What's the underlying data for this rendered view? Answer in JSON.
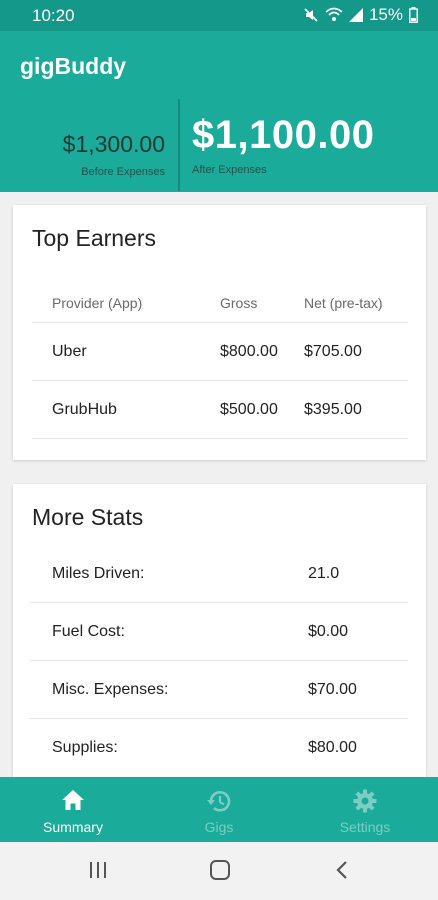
{
  "status": {
    "time": "10:20",
    "battery": "15%"
  },
  "app": {
    "title": "gigBuddy"
  },
  "totals": {
    "before_amount": "$1,300.00",
    "before_label": "Before Expenses",
    "after_amount": "$1,100.00",
    "after_label": "After Expenses"
  },
  "top_earners": {
    "title": "Top Earners",
    "columns": [
      "Provider (App)",
      "Gross",
      "Net (pre-tax)"
    ],
    "rows": [
      [
        "Uber",
        "$800.00",
        "$705.00"
      ],
      [
        "GrubHub",
        "$500.00",
        "$395.00"
      ]
    ]
  },
  "more_stats": {
    "title": "More Stats",
    "rows": [
      [
        "Miles Driven:",
        "21.0"
      ],
      [
        "Fuel Cost:",
        "$0.00"
      ],
      [
        "Misc. Expenses:",
        "$70.00"
      ],
      [
        "Supplies:",
        "$80.00"
      ]
    ]
  },
  "bottom_nav": {
    "items": [
      {
        "label": "Summary",
        "icon": "home-icon"
      },
      {
        "label": "Gigs",
        "icon": "history-icon"
      },
      {
        "label": "Settings",
        "icon": "gear-icon"
      }
    ],
    "active": "Summary"
  },
  "colors": {
    "primary": "#1bab9b",
    "status_bar": "#14988a",
    "inactive_nav": "#7ccdc3"
  }
}
